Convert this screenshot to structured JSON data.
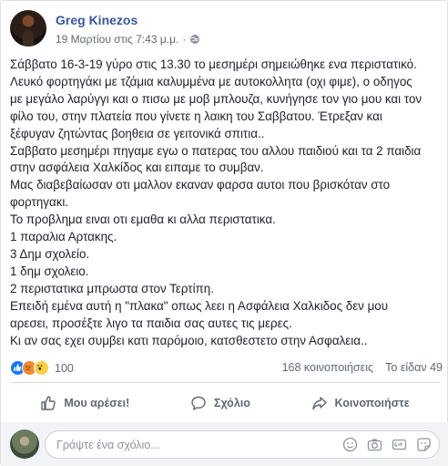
{
  "post": {
    "author": "Greg Kinezos",
    "timestamp": "19 Μαρτίου στις 7:43 μ.μ.",
    "privacy_icon": "globe-icon",
    "lines": [
      "Σάββατο 16-3-19 γύρο στις 13.30 το μεσημέρι σημειώθηκε ενα περιστατικό.",
      "Λευκό φορτηγάκι με τζάμια καλυμμένα με αυτοκολλητα (οχι φιμε), ο οδηγος",
      "με μεγάλο λαρύγγι και ο πισω με μοβ μπλουζα, κυνήγησε τον γιο μου και τον",
      "φίλο του, στην πλατεία που γίνετε η λαικη του Σαββατου. Έτρεξαν και",
      "ξέφυγαν ζητώντας βοηθεια σε γειτονικά σπιτια..",
      "Σαββατο μεσημέρι πηγαμε εγω ο πατερας του αλλου παιδιού και τα 2 παιδια",
      "στην ασφάλεια Χαλκίδος και ειπαμε το συμβαν.",
      "Μας διαβεβαίωσαν οτι μαλλον εκαναν φαρσα αυτοι που βρισκόταν στο",
      "φορτηγακι.",
      "Το προβλημα ειναι οτι εμαθα κι αλλα περιστατικα.",
      "1 παραλια Αρτακης.",
      "3 Δημ σχολείο.",
      "1 δημ σχολειο.",
      "2 περιστατικα μπρωστα στον Τερτίπη.",
      "Επειδή εμένα αυτή η \"πλακα\" οπως λεει η Ασφάλεια Χαλκιδος δεν μου",
      "αρεσει, προσέξτε λιγο τα παιδια σας αυτες τις μερες.",
      "Κι αν σας εχει συμβει κατι παρόμοιο, κατσθεστετο στην Ασφαλεια.."
    ]
  },
  "stats": {
    "reaction_icons": [
      "like-icon",
      "angry-icon",
      "wow-icon"
    ],
    "reaction_count": "100",
    "shares": "168 κοινοποιήσεις",
    "seen": "Το είδαν 49"
  },
  "actions": {
    "like": "Μου αρέσει!",
    "comment": "Σχόλιο",
    "share": "Κοινοποιήστε"
  },
  "comment_input": {
    "placeholder": "Γράψτε ένα σχόλιο...",
    "icons": [
      "emoji-icon",
      "camera-icon",
      "gif-icon",
      "sticker-icon"
    ]
  },
  "colors": {
    "author": "#385898",
    "meta": "#616770",
    "like_blue": "#1877f2"
  }
}
